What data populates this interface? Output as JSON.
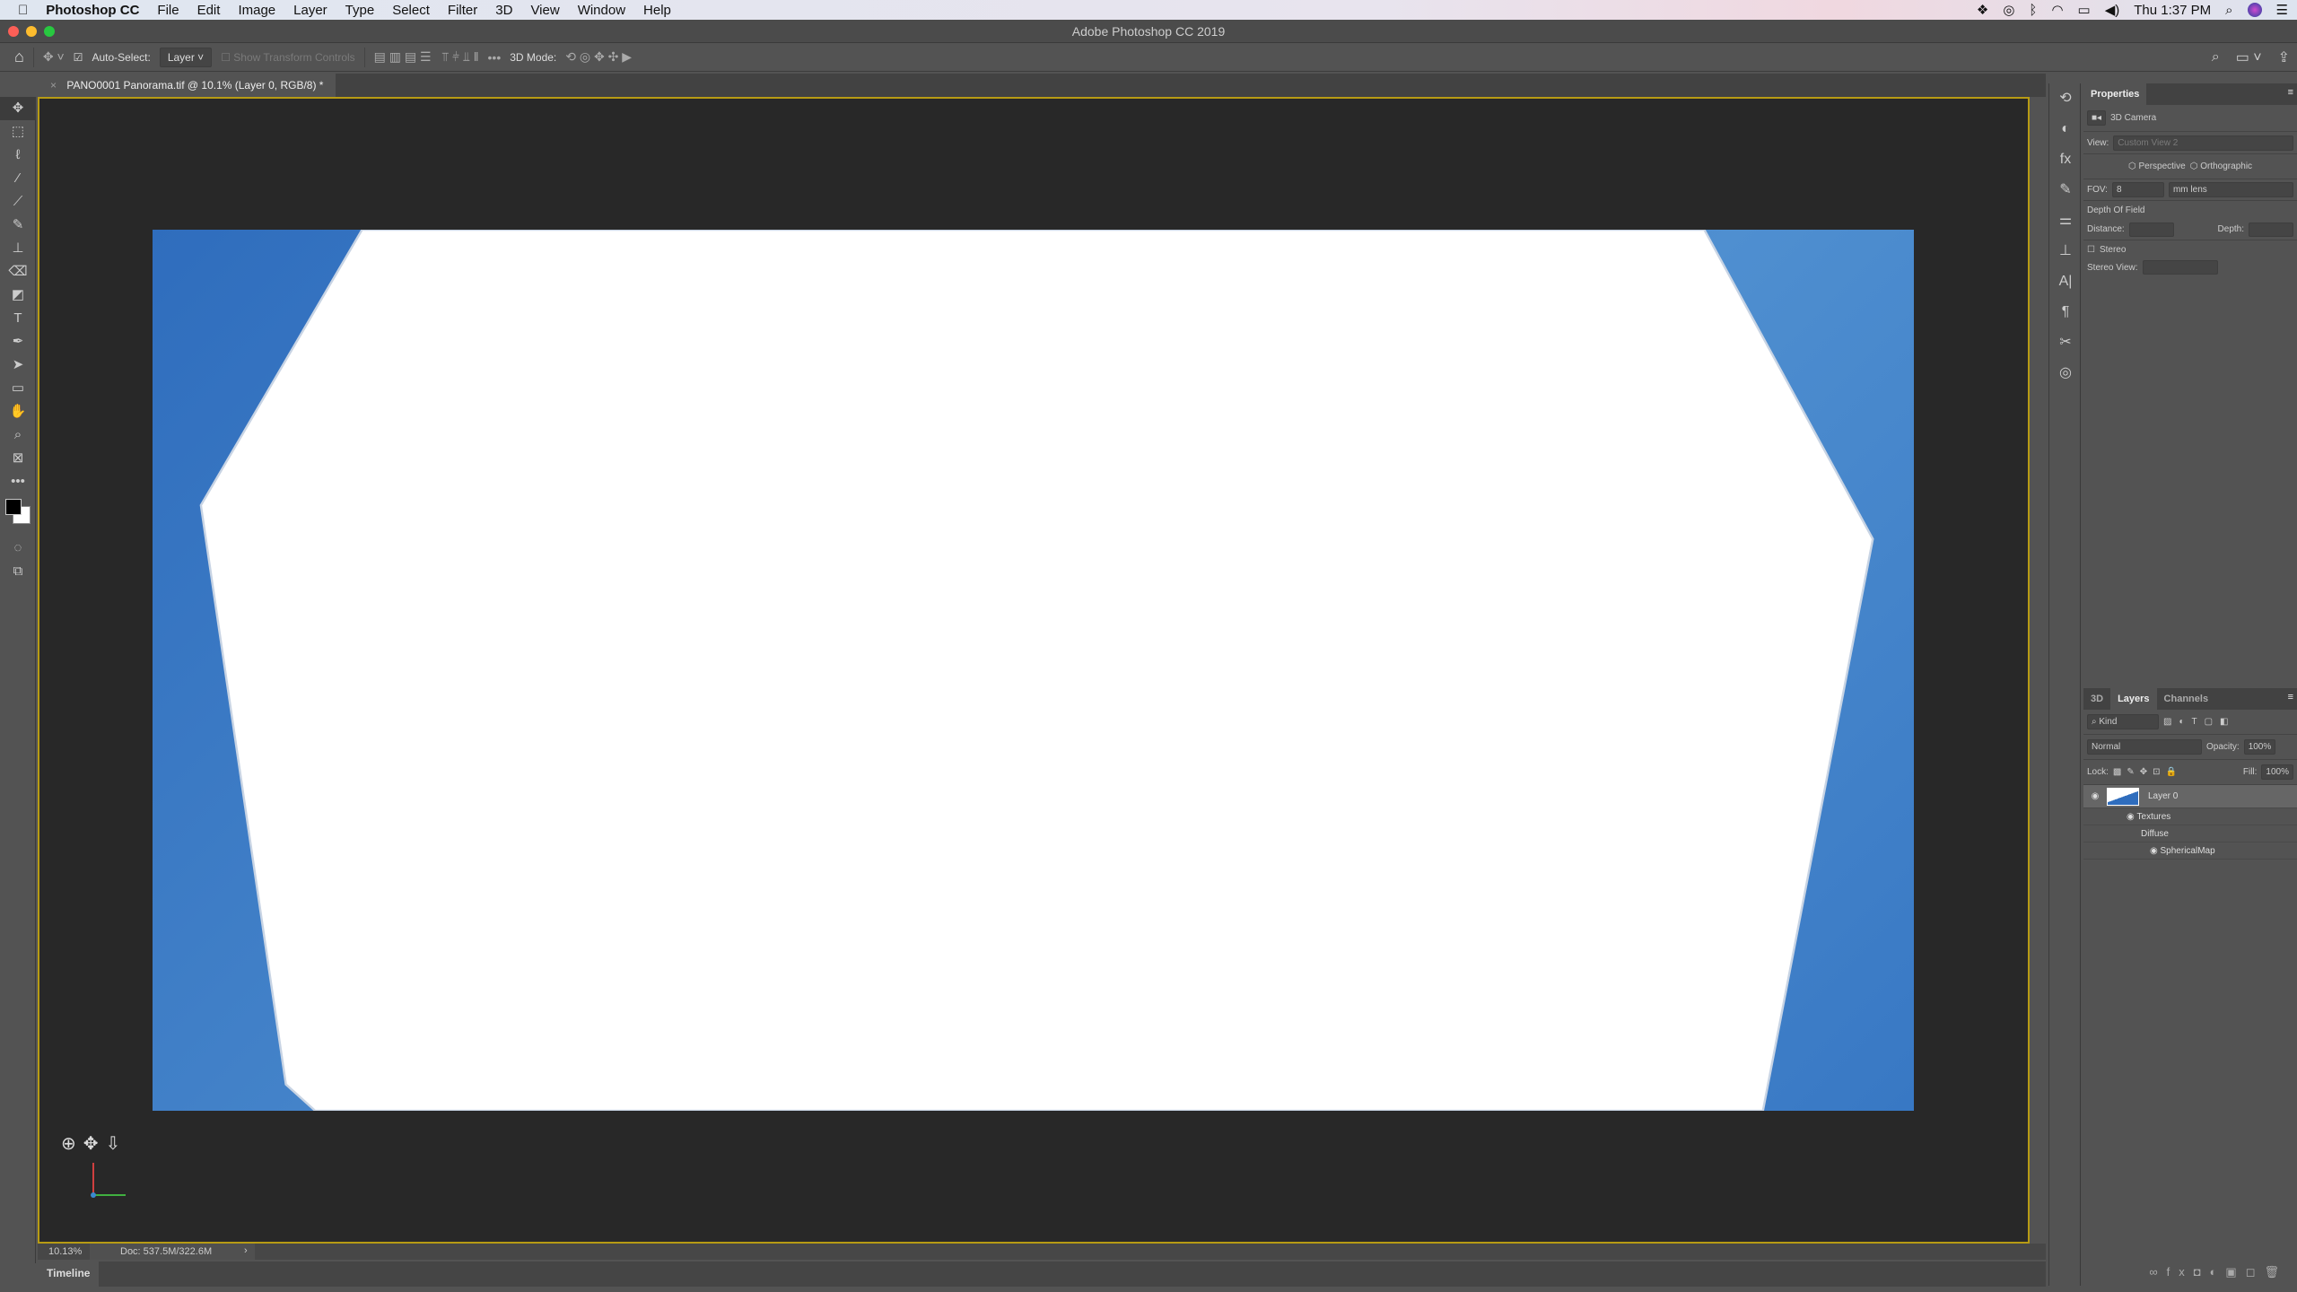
{
  "menubar": {
    "app": "Photoshop CC",
    "items": [
      "File",
      "Edit",
      "Image",
      "Layer",
      "Type",
      "Select",
      "Filter",
      "3D",
      "View",
      "Window",
      "Help"
    ],
    "clock": "Thu 1:37 PM"
  },
  "window": {
    "title": "Adobe Photoshop CC 2019"
  },
  "options": {
    "auto_select_label": "Auto-Select:",
    "auto_select_checked": true,
    "auto_select_value": "Layer",
    "show_transform": "Show Transform Controls",
    "mode_label": "3D Mode:"
  },
  "document": {
    "tab_title": "PANO0001 Panorama.tif @ 10.1% (Layer 0, RGB/8) *",
    "zoom": "10.13%",
    "doc_size": "Doc: 537.5M/322.6M"
  },
  "timeline": {
    "label": "Timeline"
  },
  "properties": {
    "title": "Properties",
    "type": "3D Camera",
    "view_label": "View:",
    "view_value": "Custom View 2",
    "perspective": "Perspective",
    "orthographic": "Orthographic",
    "fov_label": "FOV:",
    "fov_value": "8",
    "lens": "mm lens",
    "dof": "Depth Of Field",
    "distance": "Distance:",
    "depth": "Depth:",
    "stereo": "Stereo",
    "stereo_view": "Stereo View:"
  },
  "layers": {
    "tabs": [
      "3D",
      "Layers",
      "Channels"
    ],
    "active_tab": "Layers",
    "filter": "Kind",
    "blend": "Normal",
    "opacity_label": "Opacity:",
    "opacity": "100%",
    "lock_label": "Lock:",
    "fill_label": "Fill:",
    "fill": "100%",
    "items": [
      {
        "name": "Layer 0"
      },
      {
        "name": "Textures"
      },
      {
        "name": "Diffuse"
      },
      {
        "name": "SphericalMap"
      }
    ]
  },
  "colors": {
    "accent_border": "#b79b14",
    "image_blue": "#3a7cc6",
    "canvas_bg": "#282828"
  }
}
